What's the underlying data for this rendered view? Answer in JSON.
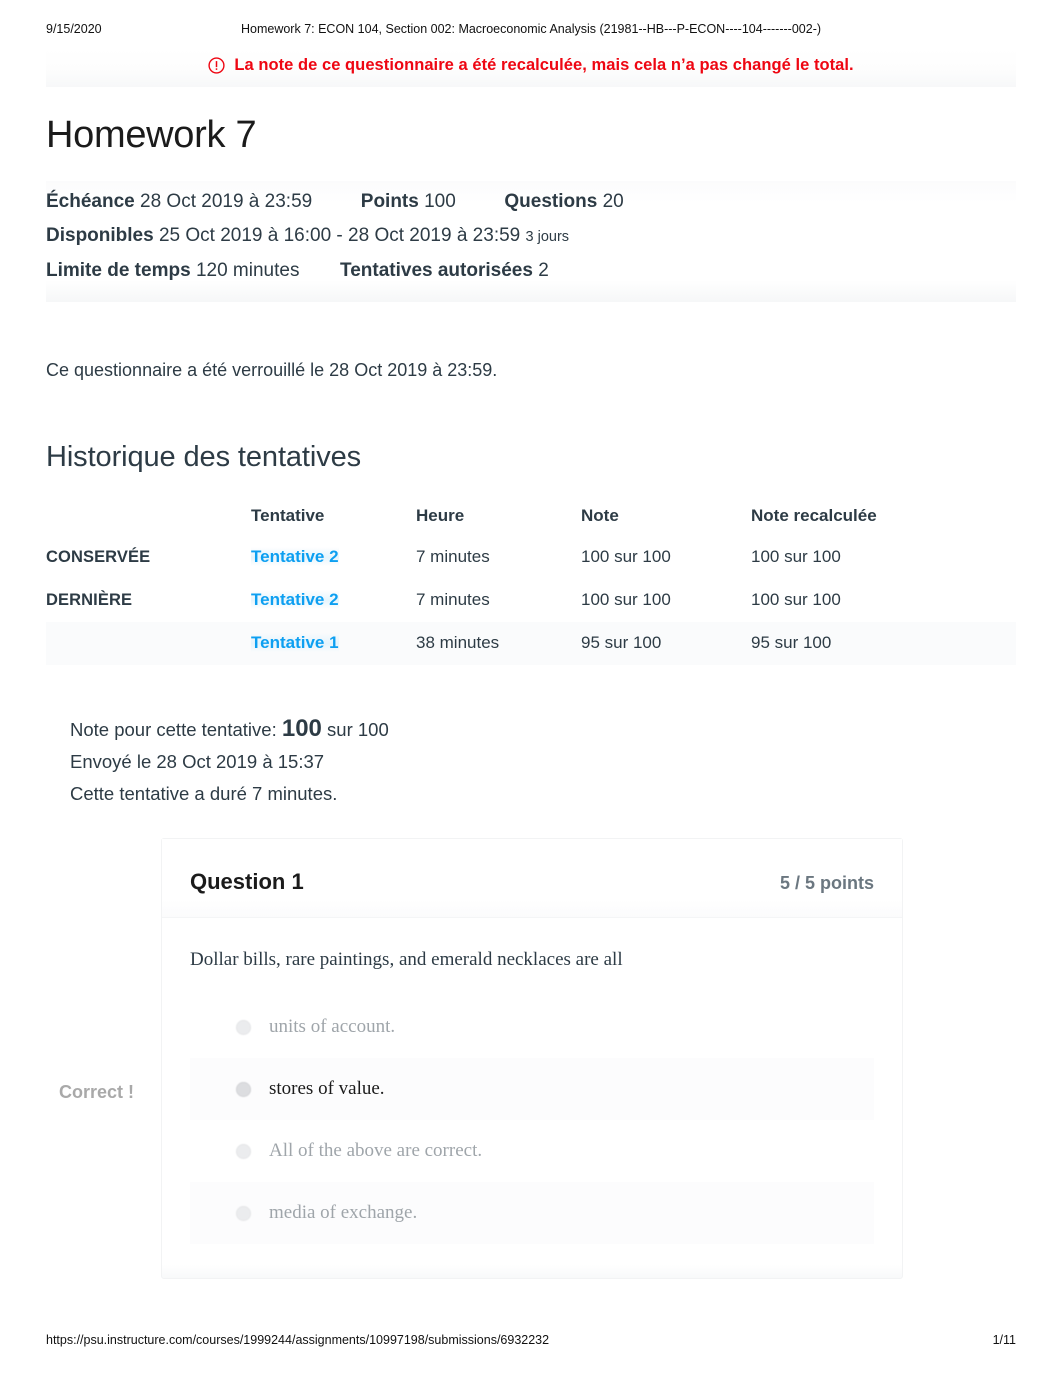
{
  "print": {
    "date": "9/15/2020",
    "doc_title": "Homework 7: ECON 104, Section 002: Macroeconomic Analysis (21981--HB---P-ECON----104-------002-)",
    "footer_url": "https://psu.instructure.com/courses/1999244/assignments/10997198/submissions/6932232",
    "footer_page": "1/11"
  },
  "alert": {
    "icon": "exclamation-circle-icon",
    "message": "La note de ce questionnaire a été recalculée, mais cela n’a pas changé le total.",
    "color": "#ee0612"
  },
  "quiz": {
    "title": "Homework 7",
    "meta": {
      "due_label": "Échéance",
      "due_value": "28 Oct 2019 à 23:59",
      "points_label": "Points",
      "points_value": "100",
      "questions_label": "Questions",
      "questions_value": "20",
      "available_label": "Disponibles",
      "available_value": "25 Oct 2019 à 16:00 - 28 Oct 2019 à 23:59",
      "available_duration": "3 jours",
      "time_limit_label": "Limite de temps",
      "time_limit_value": "120 minutes",
      "attempts_allowed_label": "Tentatives autorisées",
      "attempts_allowed_value": "2"
    },
    "locked_notice": "Ce questionnaire a été verrouillé le 28 Oct 2019 à 23:59."
  },
  "attempt_history": {
    "heading": "Historique des tentatives",
    "columns": [
      "",
      "Tentative",
      "Heure",
      "Note",
      "Note recalculée"
    ],
    "rows": [
      {
        "kept": "CONSERVÉE",
        "attempt": "Tentative 2",
        "time": "7 minutes",
        "score": "100 sur 100",
        "rescored": "100 sur 100"
      },
      {
        "kept": "DERNIÈRE",
        "attempt": "Tentative 2",
        "time": "7 minutes",
        "score": "100 sur 100",
        "rescored": "100 sur 100"
      },
      {
        "kept": "",
        "attempt": "Tentative 1",
        "time": "38 minutes",
        "score": "95 sur 100",
        "rescored": "95 sur 100"
      }
    ],
    "link_color": "#0d9ff1"
  },
  "attempt_summary": {
    "score_prefix": "Note pour cette tentative:",
    "score_value": "100",
    "score_suffix": "sur 100",
    "submitted": "Envoyé le 28 Oct 2019 à 15:37",
    "duration": "Cette tentative a duré 7 minutes."
  },
  "question": {
    "correct_flag": "Correct !",
    "name": "Question 1",
    "points": "5 / 5 points",
    "text": "Dollar bills, rare paintings, and emerald necklaces are all",
    "answers": [
      {
        "label": "units of account.",
        "selected": false
      },
      {
        "label": "stores of value.",
        "selected": true
      },
      {
        "label": "All of the above are correct.",
        "selected": false
      },
      {
        "label": "media of exchange.",
        "selected": false
      }
    ]
  }
}
